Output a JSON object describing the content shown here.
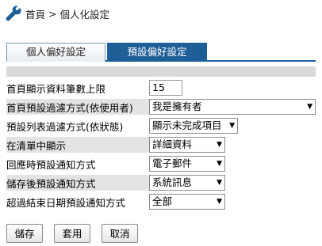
{
  "breadcrumb": {
    "home": "首頁",
    "separator": ">",
    "current": "個人化設定"
  },
  "tabs": [
    {
      "label": "個人偏好設定",
      "active": false
    },
    {
      "label": "預設偏好設定",
      "active": true
    }
  ],
  "form": {
    "rows": [
      {
        "label": "首頁顯示資料筆數上限",
        "value": "15"
      },
      {
        "label": "首頁預設過濾方式(依使用者)",
        "value": "我是擁有者"
      },
      {
        "label": "預設列表過濾方式(依狀態)",
        "value": "顯示未完成項目"
      },
      {
        "label": "在清單中顯示",
        "value": "詳細資料"
      },
      {
        "label": "回應時預設通知方式",
        "value": "電子郵件"
      },
      {
        "label": "儲存後預設通知方式",
        "value": "系統訊息"
      },
      {
        "label": "超過結束日期預設通知方式",
        "value": "全部"
      }
    ]
  },
  "buttons": {
    "save": "儲存",
    "apply": "套用",
    "cancel": "取消"
  },
  "icons": {
    "breadcrumb": "wrench-icon",
    "dropdown": "chevron-down-icon"
  },
  "colors": {
    "accent": "#1f5f98",
    "shaded": "#e3e3e3",
    "strip": "#d9d9d9"
  }
}
